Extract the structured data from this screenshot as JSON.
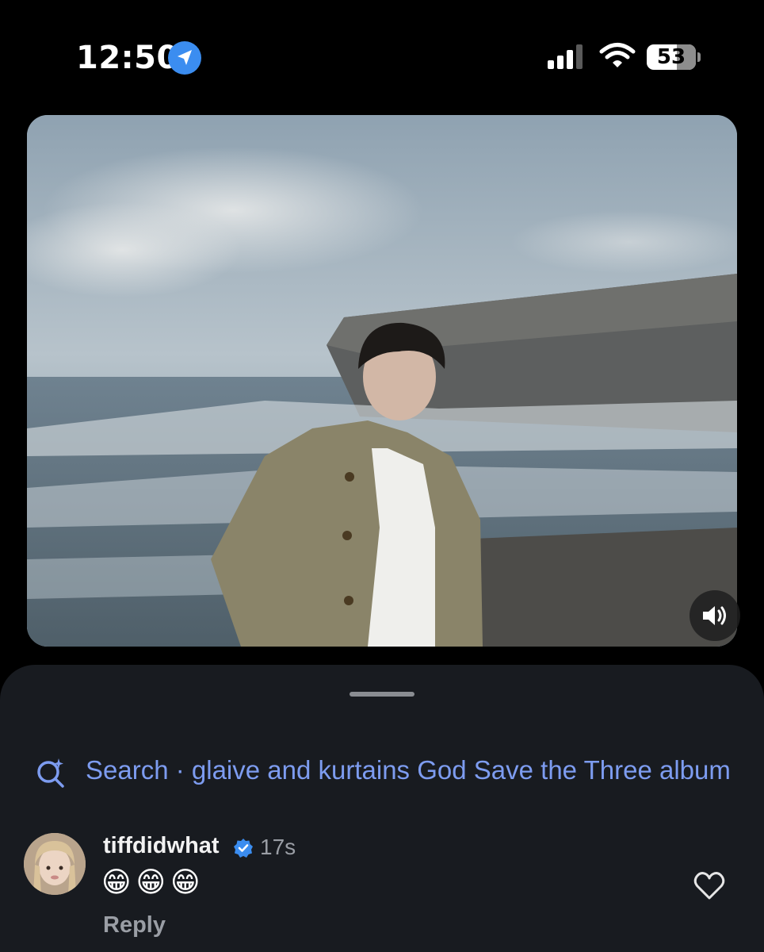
{
  "status_bar": {
    "time": "12:50",
    "battery": "53",
    "icons": [
      "location-arrow-icon",
      "cellular-signal-icon",
      "wifi-icon",
      "battery-icon"
    ]
  },
  "video": {
    "sound_icon": "speaker-volume-icon"
  },
  "sheet": {
    "search_icon": "sparkle-search-icon",
    "search_text": "Search · glaive and kurtains God Save the Three album"
  },
  "comment": {
    "username": "tiffdidwhat",
    "verified": true,
    "timestamp": "17s",
    "text": "😁😁😁",
    "reply_label": "Reply",
    "like_icon": "heart-outline-icon"
  },
  "colors": {
    "background": "#000000",
    "sheet": "#181b20",
    "search_accent": "#7d9cf0",
    "verified_blue": "#3b8df0",
    "muted_text": "#9a9ea5"
  }
}
